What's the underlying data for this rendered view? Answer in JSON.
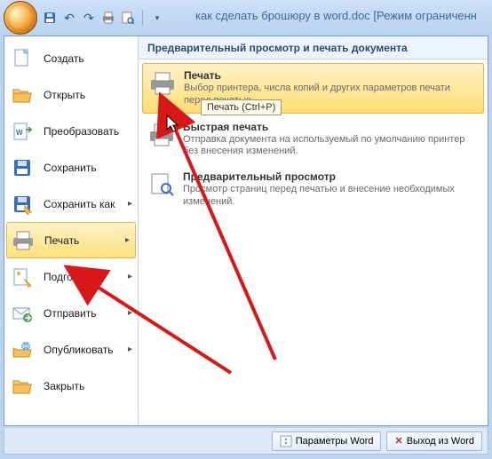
{
  "title": "как сделать брошюру в word.doc [Режим ограниченн",
  "qat": {
    "save": "save",
    "undo": "undo",
    "redo": "redo",
    "quickprint": "quickprint",
    "preview": "preview"
  },
  "menu": {
    "items": [
      {
        "label": "Создать"
      },
      {
        "label": "Открыть"
      },
      {
        "label": "Преобразовать"
      },
      {
        "label": "Сохранить"
      },
      {
        "label": "Сохранить как"
      },
      {
        "label": "Печать"
      },
      {
        "label": "Подготовить"
      },
      {
        "label": "Отправить"
      },
      {
        "label": "Опубликовать"
      },
      {
        "label": "Закрыть"
      }
    ]
  },
  "panel": {
    "header": "Предварительный просмотр и печать документа",
    "cmds": [
      {
        "title": "Печать",
        "desc": "Выбор принтера, числа копий и других параметров печати перед печатью"
      },
      {
        "title": "Быстрая печать",
        "desc": "Отправка документа на используемый по умолчанию принтер без внесения изменений."
      },
      {
        "title": "Предварительный просмотр",
        "desc": "Просмотр страниц перед печатью и внесение необходимых изменений."
      }
    ],
    "tooltip": "Печать (Ctrl+P)"
  },
  "footer": {
    "options": "Параметры Word",
    "exit": "Выход из Word"
  }
}
